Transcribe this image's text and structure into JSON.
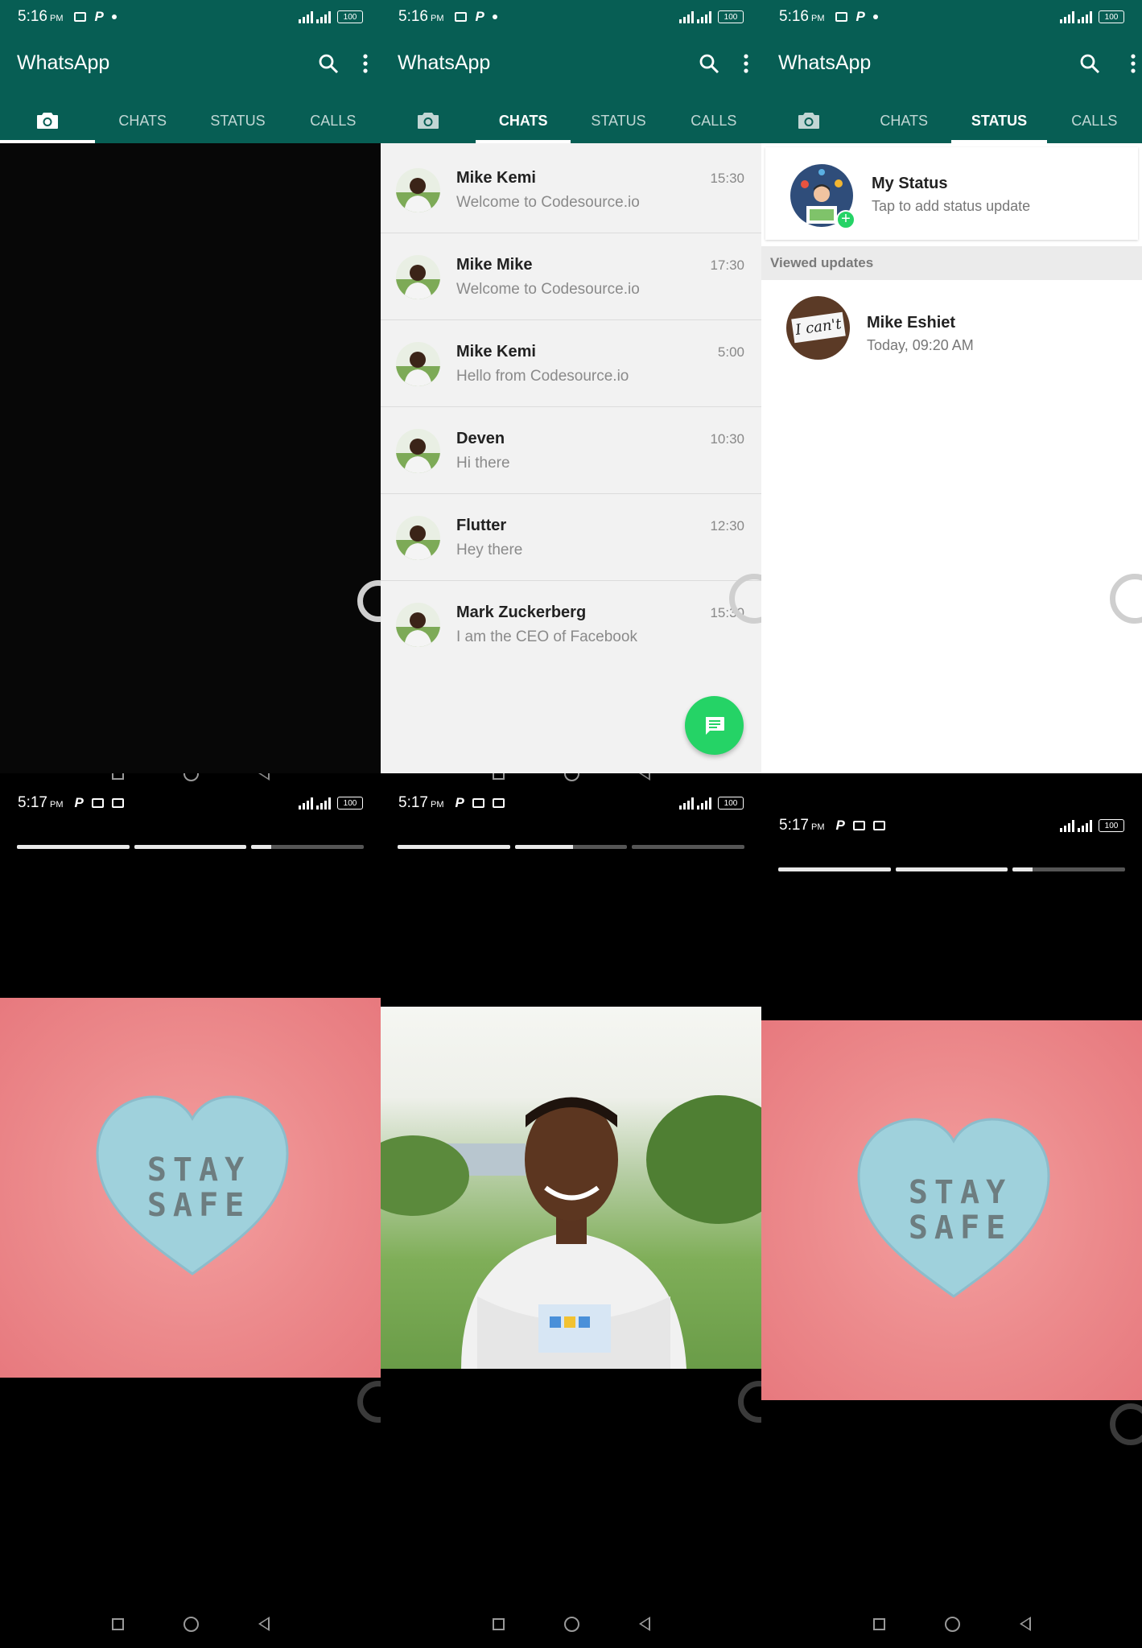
{
  "panels_top": [
    {
      "status_time": "5:16",
      "status_ampm": "PM",
      "status_battery": "100",
      "app_title": "WhatsApp",
      "tabs": [
        "CHATS",
        "STATUS",
        "CALLS"
      ],
      "active_tab": "camera"
    },
    {
      "status_time": "5:16",
      "status_ampm": "PM",
      "status_battery": "100",
      "app_title": "WhatsApp",
      "tabs": [
        "CHATS",
        "STATUS",
        "CALLS"
      ],
      "active_tab": "CHATS"
    },
    {
      "status_time": "5:16",
      "status_ampm": "PM",
      "status_battery": "100",
      "app_title": "WhatsApp",
      "tabs": [
        "CHATS",
        "STATUS",
        "CALLS"
      ],
      "active_tab": "STATUS"
    }
  ],
  "chats": [
    {
      "name": "Mike Kemi",
      "message": "Welcome to Codesource.io",
      "time": "15:30"
    },
    {
      "name": "Mike Mike",
      "message": "Welcome to Codesource.io",
      "time": "17:30"
    },
    {
      "name": "Mike Kemi",
      "message": "Hello from Codesource.io",
      "time": "5:00"
    },
    {
      "name": "Deven",
      "message": "Hi there",
      "time": "10:30"
    },
    {
      "name": "Flutter",
      "message": "Hey there",
      "time": "12:30"
    },
    {
      "name": "Mark Zuckerberg",
      "message": "I am the CEO of Facebook",
      "time": "15:30"
    }
  ],
  "status": {
    "my_status_title": "My Status",
    "my_status_subtitle": "Tap to add status update",
    "viewed_header": "Viewed updates",
    "viewed": [
      {
        "name": "Mike Eshiet",
        "time": "Today, 09:20 AM",
        "thumb_text": "I can't"
      }
    ]
  },
  "stories": [
    {
      "status_time": "5:17",
      "status_ampm": "PM",
      "status_battery": "100",
      "progress": [
        1.0,
        1.0,
        0.18
      ],
      "image_text": [
        "STAY",
        "SAFE"
      ]
    },
    {
      "status_time": "5:17",
      "status_ampm": "PM",
      "status_battery": "100",
      "progress": [
        1.0,
        0.52,
        0.0
      ]
    },
    {
      "status_time": "5:17",
      "status_ampm": "PM",
      "status_battery": "100",
      "progress": [
        1.0,
        1.0,
        0.18
      ],
      "image_text": [
        "STAY",
        "SAFE"
      ]
    }
  ],
  "colors": {
    "header": "#075e54",
    "fab": "#25d366",
    "status_ring_add": "#25d366"
  },
  "icons": {
    "camera": "camera-icon",
    "search": "search-icon",
    "more": "more-vert-icon",
    "fab": "message-icon"
  }
}
